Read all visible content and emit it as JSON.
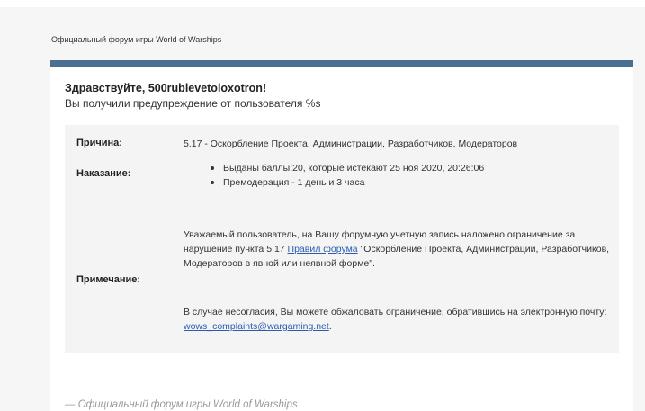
{
  "header": {
    "site_title": "Официальный форум игры World of Warships"
  },
  "message": {
    "greeting": "Здравствуйте, 500rublevetoloxotron!",
    "subtitle": "Вы получили предупреждение от пользователя %s"
  },
  "details": {
    "reason_label": "Причина:",
    "reason_value": "5.17 - Оскорбление Проекта, Администрации, Разработчиков, Модераторов",
    "punishment_label": "Наказание:",
    "punishment_items": [
      "Выданы баллы:20, которые истекают 25 ноя 2020, 20:26:06",
      "Премодерация - 1 день и 3 часа"
    ],
    "note_label": "Примечание:",
    "note_p1_before": "Уважаемый пользователь, на Вашу форумную учетную запись наложено ограничение за нарушение пункта 5.17 ",
    "note_p1_link": "Правил форума",
    "note_p1_after": " \"Оскорбление Проекта, Администрации, Разработчиков, Модераторов в явной или неявной форме\".",
    "note_p2_before": "В случае несогласия, Вы можете обжаловать ограничение, обратившись на электронную почту: ",
    "note_p2_link": "wows_complaints@wargaming.net",
    "note_p2_after": "."
  },
  "footer": {
    "signature": "— Официальный форум игры World of Warships"
  },
  "colors": {
    "accent_bar": "#4a6f91",
    "link": "#2a5db0",
    "panel_bg": "#f4f4f4"
  }
}
